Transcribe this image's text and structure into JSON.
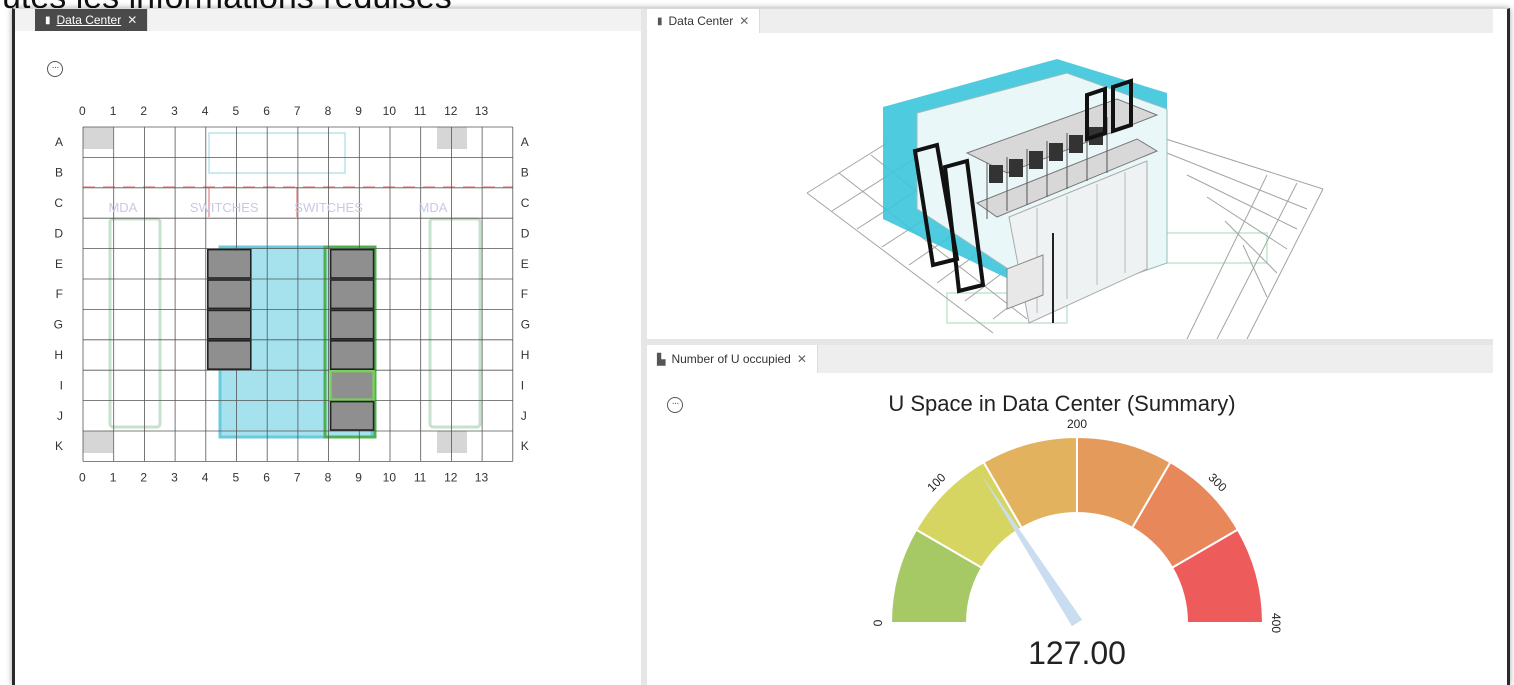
{
  "background_text": "utes les informations requises",
  "left_panel": {
    "tab_label": "Data Center",
    "col_labels": [
      "0",
      "1",
      "2",
      "3",
      "4",
      "5",
      "6",
      "7",
      "8",
      "9",
      "10",
      "11",
      "12",
      "13"
    ],
    "row_labels": [
      "A",
      "B",
      "C",
      "D",
      "E",
      "F",
      "G",
      "H",
      "I",
      "J",
      "K"
    ],
    "zone_labels": [
      "MDA",
      "SWITCHES",
      "SWITCHES",
      "MDA"
    ]
  },
  "view3d_panel": {
    "tab_label": "Data Center"
  },
  "gauge_panel": {
    "tab_label": "Number of U occupied",
    "title": "U Space in Data Center (Summary)",
    "value_text": "127.00",
    "chart_data": {
      "type": "gauge",
      "title": "U Space in Data Center (Summary)",
      "min": 0,
      "max": 400,
      "value": 127,
      "tick_labels": [
        "0",
        "100",
        "200",
        "300",
        "400"
      ],
      "bands": [
        {
          "from": 0,
          "to": 67,
          "color": "#a6c966"
        },
        {
          "from": 67,
          "to": 133,
          "color": "#d6d561"
        },
        {
          "from": 133,
          "to": 200,
          "color": "#e2b25e"
        },
        {
          "from": 200,
          "to": 267,
          "color": "#e39a5a"
        },
        {
          "from": 267,
          "to": 333,
          "color": "#e8875a"
        },
        {
          "from": 333,
          "to": 400,
          "color": "#ee5b5b"
        }
      ],
      "needle_color": "#c9dcf0"
    }
  }
}
